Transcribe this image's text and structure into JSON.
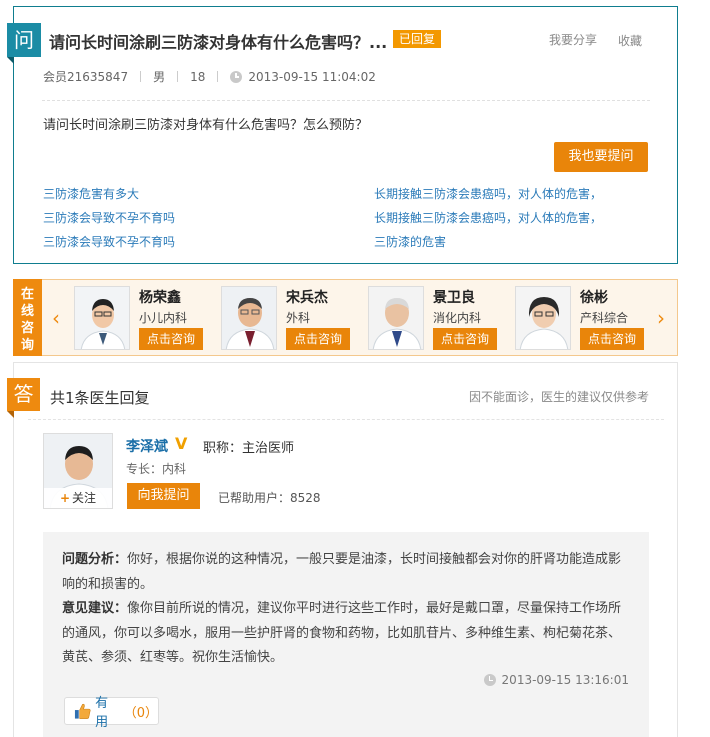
{
  "question": {
    "badge": "问",
    "title": "请问长时间涂刷三防漆对身体有什么危害吗？...",
    "status": "已回复",
    "share_label": "我要分享",
    "fav_label": "收藏",
    "member": "会员21635847",
    "gender": "男",
    "age": "18",
    "time": "2013-09-15 11:04:02",
    "body": "请问长时间涂刷三防漆对身体有什么危害吗？怎么预防？",
    "ask_button": "我也要提问",
    "related_links": [
      "三防漆危害有多大",
      "长期接触三防漆会患癌吗，对人体的危害，",
      "三防漆会导致不孕不育吗",
      "长期接触三防漆会患癌吗，对人体的危害，",
      "三防漆会导致不孕不育吗",
      "三防漆的危害"
    ]
  },
  "doctors_strip": {
    "tag": "在线咨询",
    "prev_icon": "chevron-left-icon",
    "next_icon": "chevron-right-icon",
    "doctors": [
      {
        "name": "杨荣鑫",
        "dept": "小儿内科",
        "button": "点击咨询"
      },
      {
        "name": "宋兵杰",
        "dept": "外科",
        "button": "点击咨询"
      },
      {
        "name": "景卫良",
        "dept": "消化内科",
        "button": "点击咨询"
      },
      {
        "name": "徐彬",
        "dept": "产科综合",
        "button": "点击咨询"
      }
    ]
  },
  "answers": {
    "badge": "答",
    "count_text": "共1条医生回复",
    "note": "因不能面诊，医生的建议仅供参考",
    "doctor": {
      "name": "李泽斌",
      "verified": "V",
      "title": "职称：主治医师",
      "specialty": "专长：内科",
      "follow_label": "关注",
      "ask_button": "向我提问",
      "helped": "已帮助用户：8528"
    },
    "reply": {
      "analysis_label": "问题分析：",
      "analysis": "你好，根据你说的这种情况，一般只要是油漆，长时间接触都会对你的肝肾功能造成影响的和损害的。",
      "advice_label": "意见建议：",
      "advice": "像你目前所说的情况，建议你平时进行这些工作时，最好是戴口罩，尽量保持工作场所的通风，你可以多喝水，服用一些护肝肾的食物和药物，比如肌苷片、多种维生素、枸杞菊花茶、黄芪、参须、红枣等。祝你生活愉快。",
      "time": "2013-09-15 13:16:01",
      "useful_label": "有用",
      "useful_count": "（0）"
    }
  },
  "colors": {
    "teal": "#1b8ca5",
    "orange": "#e9850a",
    "link_blue": "#2b7bb9"
  }
}
